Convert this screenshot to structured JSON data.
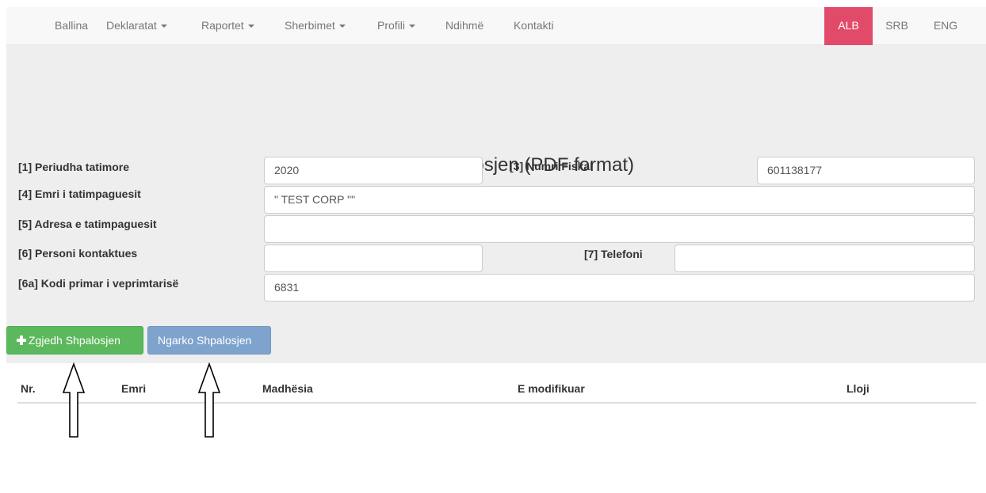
{
  "nav": {
    "items": [
      {
        "label": "Ballina",
        "dropdown": false
      },
      {
        "label": "Deklaratat",
        "dropdown": true
      },
      {
        "label": "Raportet",
        "dropdown": true
      },
      {
        "label": "Sherbimet",
        "dropdown": true
      },
      {
        "label": "Profili",
        "dropdown": true
      },
      {
        "label": "Ndihmë",
        "dropdown": false
      },
      {
        "label": "Kontakti",
        "dropdown": false
      }
    ],
    "languages": [
      {
        "label": "ALB",
        "active": true
      },
      {
        "label": "SRB",
        "active": false
      },
      {
        "label": "ENG",
        "active": false
      }
    ]
  },
  "page": {
    "title": "Ngarko Shpalosjen (PDF format)"
  },
  "form": {
    "period_label": "[1] Periudha tatimore",
    "period_value": "2020",
    "fiscal_label": "[3] Numri Fiskal",
    "fiscal_value": "601138177",
    "name_label": "[4] Emri i tatimpaguesit",
    "name_value": "\" TEST CORP \"\"",
    "address_label": "[5] Adresa e tatimpaguesit",
    "address_value": "",
    "contact_label": "[6] Personi kontaktues",
    "contact_value": "",
    "phone_label": "[7] Telefoni",
    "phone_value": "",
    "code_label": "[6a] Kodi primar i veprimtarisë",
    "code_value": "6831"
  },
  "buttons": {
    "choose": "Zgjedh Shpalosjen",
    "upload": "Ngarko Shpalosjen"
  },
  "table": {
    "columns": [
      "Nr.",
      "Emri",
      "Madhësia",
      "E modifikuar",
      "Lloji"
    ]
  },
  "colors": {
    "active_lang": "#e24a6a",
    "choose_button": "#5cb85c",
    "upload_button": "#7ea3cc"
  }
}
